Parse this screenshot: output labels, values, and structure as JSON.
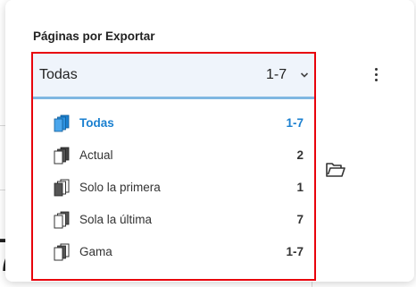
{
  "dialog": {
    "title": "Páginas por Exportar"
  },
  "select": {
    "label": "Todas",
    "range": "1-7"
  },
  "options": [
    {
      "label": "Todas",
      "value": "1-7",
      "icon": "pages-all-icon",
      "selected": true
    },
    {
      "label": "Actual",
      "value": "2",
      "icon": "page-current-icon",
      "selected": false
    },
    {
      "label": "Solo la primera",
      "value": "1",
      "icon": "page-first-icon",
      "selected": false
    },
    {
      "label": "Sola la última",
      "value": "7",
      "icon": "page-last-icon",
      "selected": false
    },
    {
      "label": "Gama",
      "value": "1-7",
      "icon": "pages-range-icon",
      "selected": false
    }
  ],
  "background": {
    "partial_digit": "7"
  },
  "colors": {
    "accent": "#1b80d0",
    "highlight_border": "#e8000b",
    "select_underline": "#7fb7e2",
    "select_background": "#eff4fb"
  }
}
